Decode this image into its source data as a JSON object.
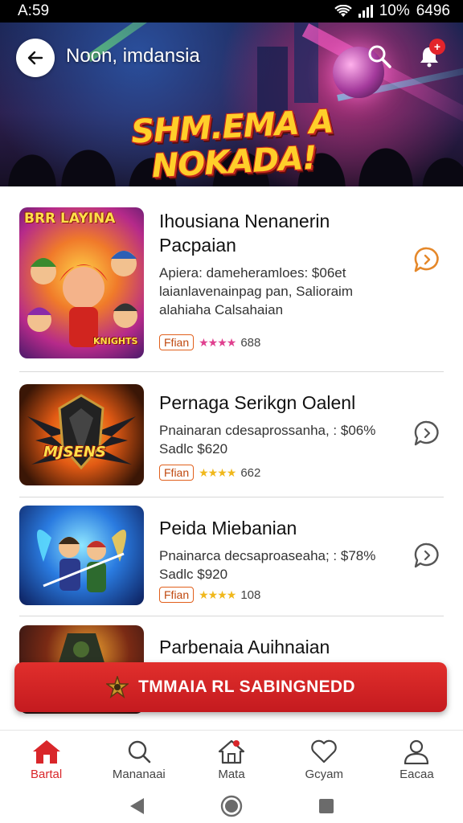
{
  "status_bar": {
    "time": "A:59",
    "battery": "10%",
    "extra": "6496"
  },
  "header": {
    "title": "Noon, imdansia",
    "notification_count": "+"
  },
  "hero": {
    "headline_line1": "SHM.EMA A",
    "headline_line2": "NOKADA!"
  },
  "list": {
    "items": [
      {
        "thumb_label": "BRR LAYINA",
        "thumb_sublabel": "KNIGHTS",
        "title_line1": "Ihousiana Nenanerin",
        "title_line2": "Pacpaian",
        "desc_line1": "Apiera: dameheramloes: $06et",
        "desc_line2": "laianlavenainpag pan, Salioraim",
        "desc_line3": "alahiaha Calsahaian",
        "tag": "Ffian",
        "stars": "★★★★",
        "rating": "688"
      },
      {
        "thumb_label": "MJSENS",
        "thumb_sublabel": "",
        "title_line1": "Pernaga Serikgn Oalenl",
        "desc_line1": "Pnainaran cdesaprossanha, : $06%",
        "desc_line2": "Sadlc $620",
        "tag": "Ffian",
        "stars": "★★★★",
        "rating": "662"
      },
      {
        "thumb_label": "",
        "thumb_sublabel": "",
        "title_line1": "Peida Miebanian",
        "desc_line1": "Pnainarca decsaproaseaha; : $78%",
        "desc_line2": "Sadlc $920",
        "tag": "Ffian",
        "stars": "★★★★",
        "rating": "108"
      },
      {
        "title_line1": "Parbenaia Auihnaian"
      }
    ]
  },
  "promo_banner": {
    "label": "TMMAIA RL SABINGNEDD"
  },
  "bottom_nav": {
    "items": [
      {
        "label": "Bartal",
        "icon": "home-icon"
      },
      {
        "label": "Mananaai",
        "icon": "search-icon"
      },
      {
        "label": "Mata",
        "icon": "house-outline-icon"
      },
      {
        "label": "Gcyam",
        "icon": "heart-icon"
      },
      {
        "label": "Eacaa",
        "icon": "person-icon"
      }
    ]
  },
  "colors": {
    "accent": "#d9262a",
    "tag_border": "#e1601c",
    "chat_orange": "#e5882a",
    "star_pink": "#e0408f",
    "star_gold": "#f0b81c"
  }
}
